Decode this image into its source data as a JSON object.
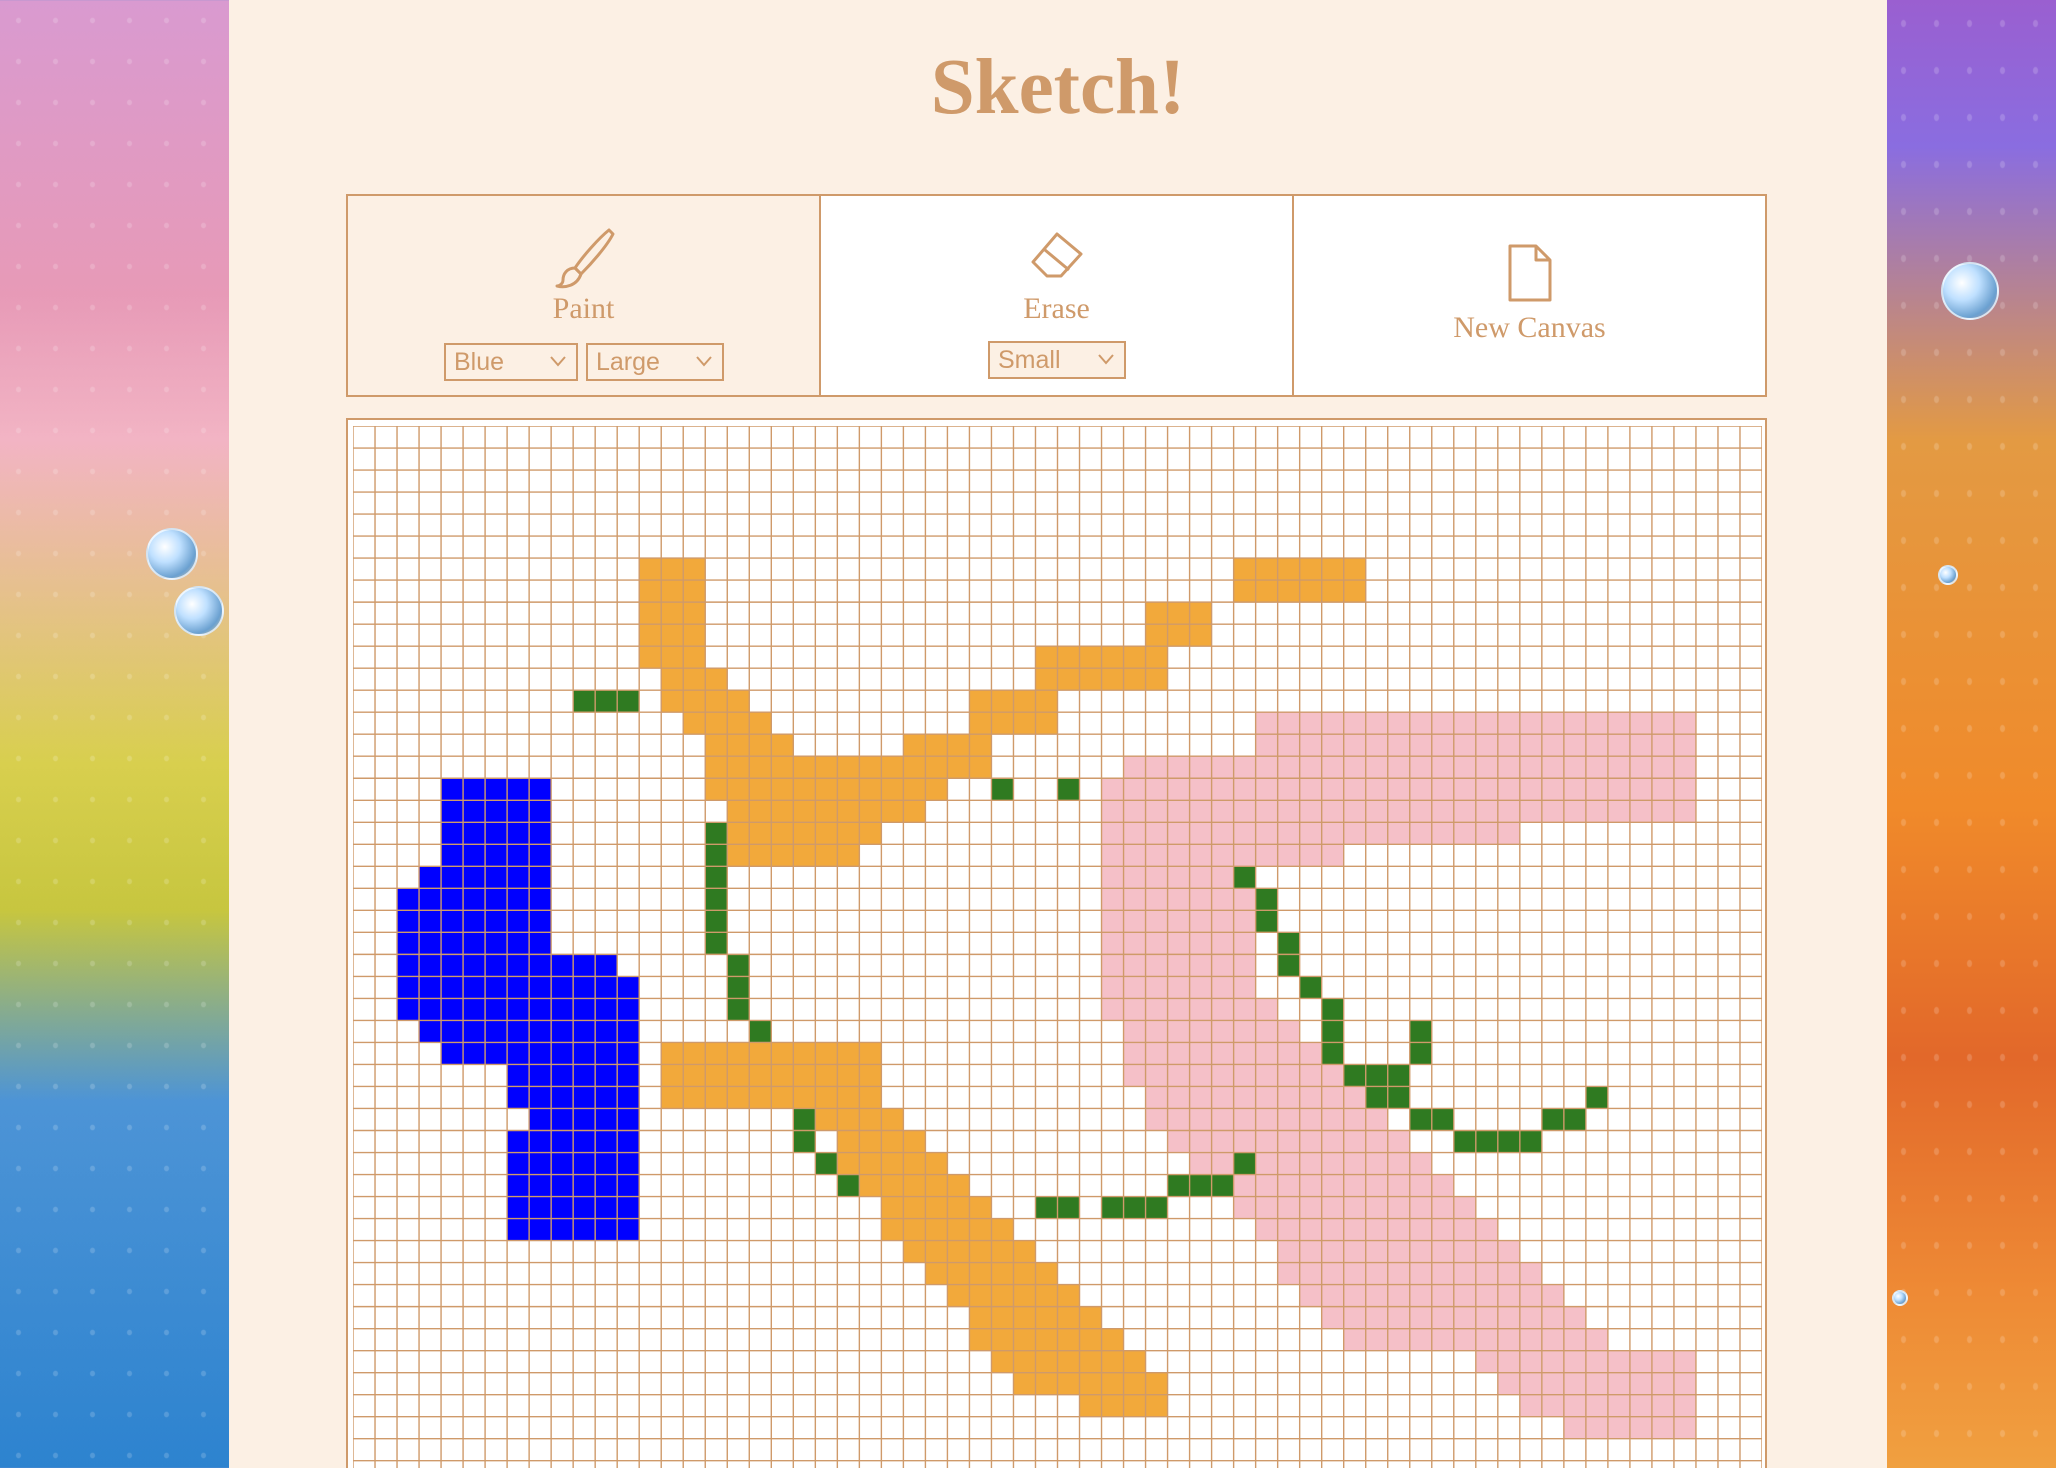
{
  "app": {
    "title": "Sketch!"
  },
  "tools": {
    "paint": {
      "label": "Paint",
      "icon": "paintbrush-icon",
      "color_select": {
        "value": "Blue"
      },
      "size_select": {
        "value": "Large"
      }
    },
    "erase": {
      "label": "Erase",
      "icon": "eraser-icon",
      "size_select": {
        "value": "Small"
      }
    },
    "new_canvas": {
      "label": "New Canvas",
      "icon": "file-icon"
    }
  },
  "colors": {
    "accent": "#cf9a6a",
    "panel_bg": "#fcf0e4",
    "grid_line": "#cf9a6a",
    "orange": "#f2a93b",
    "blue": "#0000ff",
    "pink": "#f5c0c8",
    "green": "#2f7a21"
  },
  "canvas": {
    "cols": 64,
    "rows_visible": 47,
    "painted_runs": [
      [
        "blue",
        16,
        4,
        8
      ],
      [
        "blue",
        17,
        4,
        8
      ],
      [
        "blue",
        18,
        4,
        8
      ],
      [
        "blue",
        19,
        4,
        8
      ],
      [
        "blue",
        20,
        3,
        8
      ],
      [
        "blue",
        21,
        2,
        8
      ],
      [
        "blue",
        22,
        2,
        8
      ],
      [
        "blue",
        23,
        2,
        8
      ],
      [
        "blue",
        24,
        2,
        11
      ],
      [
        "blue",
        25,
        2,
        12
      ],
      [
        "blue",
        26,
        2,
        12
      ],
      [
        "blue",
        27,
        3,
        12
      ],
      [
        "blue",
        28,
        4,
        12
      ],
      [
        "blue",
        29,
        7,
        12
      ],
      [
        "blue",
        30,
        7,
        12
      ],
      [
        "blue",
        31,
        8,
        12
      ],
      [
        "blue",
        32,
        7,
        12
      ],
      [
        "blue",
        33,
        7,
        12
      ],
      [
        "blue",
        34,
        7,
        12
      ],
      [
        "blue",
        35,
        7,
        12
      ],
      [
        "blue",
        36,
        7,
        12
      ],
      [
        "orange",
        6,
        13,
        15
      ],
      [
        "orange",
        7,
        13,
        15
      ],
      [
        "orange",
        8,
        13,
        15
      ],
      [
        "orange",
        9,
        13,
        15
      ],
      [
        "orange",
        10,
        13,
        15
      ],
      [
        "orange",
        11,
        14,
        16
      ],
      [
        "orange",
        12,
        14,
        17
      ],
      [
        "orange",
        13,
        15,
        18
      ],
      [
        "orange",
        14,
        16,
        19
      ],
      [
        "orange",
        15,
        16,
        28
      ],
      [
        "orange",
        16,
        16,
        26
      ],
      [
        "orange",
        17,
        17,
        25
      ],
      [
        "orange",
        18,
        17,
        23
      ],
      [
        "orange",
        19,
        17,
        22
      ],
      [
        "orange",
        12,
        28,
        31
      ],
      [
        "orange",
        13,
        28,
        31
      ],
      [
        "orange",
        11,
        31,
        36
      ],
      [
        "orange",
        10,
        31,
        36
      ],
      [
        "orange",
        9,
        36,
        38
      ],
      [
        "orange",
        8,
        36,
        38
      ],
      [
        "orange",
        7,
        40,
        45
      ],
      [
        "orange",
        6,
        40,
        45
      ],
      [
        "orange",
        14,
        25,
        28
      ],
      [
        "orange",
        28,
        14,
        23
      ],
      [
        "orange",
        29,
        14,
        23
      ],
      [
        "orange",
        30,
        14,
        23
      ],
      [
        "orange",
        31,
        21,
        24
      ],
      [
        "orange",
        32,
        22,
        25
      ],
      [
        "orange",
        33,
        22,
        26
      ],
      [
        "orange",
        34,
        23,
        27
      ],
      [
        "orange",
        35,
        24,
        28
      ],
      [
        "orange",
        36,
        24,
        29
      ],
      [
        "orange",
        37,
        25,
        30
      ],
      [
        "orange",
        38,
        26,
        31
      ],
      [
        "orange",
        39,
        27,
        32
      ],
      [
        "orange",
        40,
        28,
        33
      ],
      [
        "orange",
        41,
        28,
        34
      ],
      [
        "orange",
        42,
        29,
        35
      ],
      [
        "orange",
        43,
        30,
        36
      ],
      [
        "orange",
        44,
        33,
        36
      ],
      [
        "pink",
        13,
        41,
        60
      ],
      [
        "pink",
        14,
        41,
        60
      ],
      [
        "pink",
        15,
        35,
        60
      ],
      [
        "pink",
        16,
        34,
        60
      ],
      [
        "pink",
        17,
        34,
        60
      ],
      [
        "pink",
        18,
        34,
        52
      ],
      [
        "pink",
        19,
        34,
        44
      ],
      [
        "pink",
        20,
        34,
        40
      ],
      [
        "pink",
        21,
        34,
        40
      ],
      [
        "pink",
        22,
        34,
        40
      ],
      [
        "pink",
        23,
        34,
        40
      ],
      [
        "pink",
        24,
        34,
        40
      ],
      [
        "pink",
        25,
        34,
        40
      ],
      [
        "pink",
        26,
        34,
        41
      ],
      [
        "pink",
        27,
        35,
        42
      ],
      [
        "pink",
        28,
        35,
        43
      ],
      [
        "pink",
        29,
        35,
        44
      ],
      [
        "pink",
        30,
        36,
        45
      ],
      [
        "pink",
        31,
        36,
        46
      ],
      [
        "pink",
        32,
        37,
        47
      ],
      [
        "pink",
        33,
        38,
        48
      ],
      [
        "pink",
        34,
        39,
        49
      ],
      [
        "pink",
        35,
        40,
        50
      ],
      [
        "pink",
        36,
        41,
        51
      ],
      [
        "pink",
        37,
        42,
        52
      ],
      [
        "pink",
        38,
        42,
        53
      ],
      [
        "pink",
        39,
        43,
        54
      ],
      [
        "pink",
        40,
        44,
        55
      ],
      [
        "pink",
        41,
        45,
        56
      ],
      [
        "pink",
        42,
        51,
        60
      ],
      [
        "pink",
        43,
        52,
        60
      ],
      [
        "pink",
        44,
        53,
        60
      ],
      [
        "pink",
        45,
        55,
        60
      ],
      [
        "green",
        12,
        10,
        12
      ],
      [
        "green",
        16,
        29,
        29
      ],
      [
        "green",
        16,
        32,
        32
      ],
      [
        "green",
        18,
        16,
        16
      ],
      [
        "green",
        19,
        16,
        16
      ],
      [
        "green",
        20,
        16,
        16
      ],
      [
        "green",
        21,
        16,
        16
      ],
      [
        "green",
        22,
        16,
        16
      ],
      [
        "green",
        23,
        16,
        16
      ],
      [
        "green",
        24,
        17,
        17
      ],
      [
        "green",
        25,
        17,
        17
      ],
      [
        "green",
        26,
        17,
        17
      ],
      [
        "green",
        27,
        18,
        18
      ],
      [
        "green",
        31,
        20,
        20
      ],
      [
        "green",
        32,
        20,
        20
      ],
      [
        "green",
        33,
        21,
        21
      ],
      [
        "green",
        34,
        22,
        22
      ],
      [
        "green",
        20,
        40,
        40
      ],
      [
        "green",
        21,
        41,
        41
      ],
      [
        "green",
        22,
        41,
        41
      ],
      [
        "green",
        23,
        42,
        42
      ],
      [
        "green",
        24,
        42,
        42
      ],
      [
        "green",
        25,
        43,
        43
      ],
      [
        "green",
        26,
        44,
        44
      ],
      [
        "green",
        27,
        44,
        44
      ],
      [
        "green",
        28,
        44,
        44
      ],
      [
        "green",
        27,
        48,
        48
      ],
      [
        "green",
        28,
        48,
        48
      ],
      [
        "green",
        29,
        45,
        47
      ],
      [
        "green",
        30,
        46,
        47
      ],
      [
        "green",
        31,
        48,
        49
      ],
      [
        "green",
        32,
        50,
        53
      ],
      [
        "green",
        31,
        54,
        55
      ],
      [
        "green",
        30,
        56,
        56
      ],
      [
        "green",
        35,
        31,
        32
      ],
      [
        "green",
        35,
        34,
        36
      ],
      [
        "green",
        34,
        37,
        39
      ],
      [
        "green",
        33,
        40,
        40
      ]
    ]
  }
}
